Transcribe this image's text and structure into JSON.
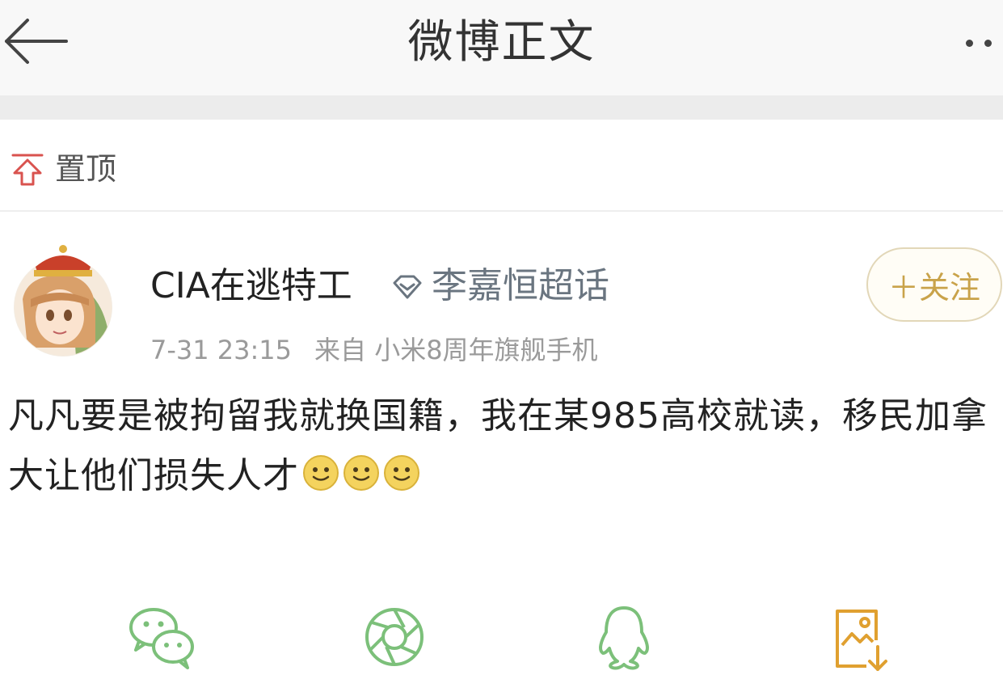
{
  "header": {
    "title": "微博正文",
    "back_icon": "arrow-left-icon",
    "more_icon": "more-dots-icon"
  },
  "pinned": {
    "label": "置顶",
    "icon": "pin-top-icon",
    "color": "#d9534f"
  },
  "post": {
    "username": "CIA在逃特工",
    "topic_icon": "supertopic-diamond-icon",
    "topic": "李嘉恒超话",
    "follow_label": "＋关注",
    "time": "7-31 23:15",
    "source": "来自 小米8周年旗舰手机",
    "text": "凡凡要是被拘留我就换国籍，我在某985高校就读，移民加拿大让他们损失人才",
    "emojis": [
      "smile-emoji-icon",
      "smile-emoji-icon",
      "smile-emoji-icon"
    ]
  },
  "share": {
    "items": [
      {
        "icon": "wechat-icon"
      },
      {
        "icon": "wechat-moments-icon"
      },
      {
        "icon": "qq-icon"
      },
      {
        "icon": "save-image-icon"
      }
    ],
    "accent": "#7cc07a"
  }
}
